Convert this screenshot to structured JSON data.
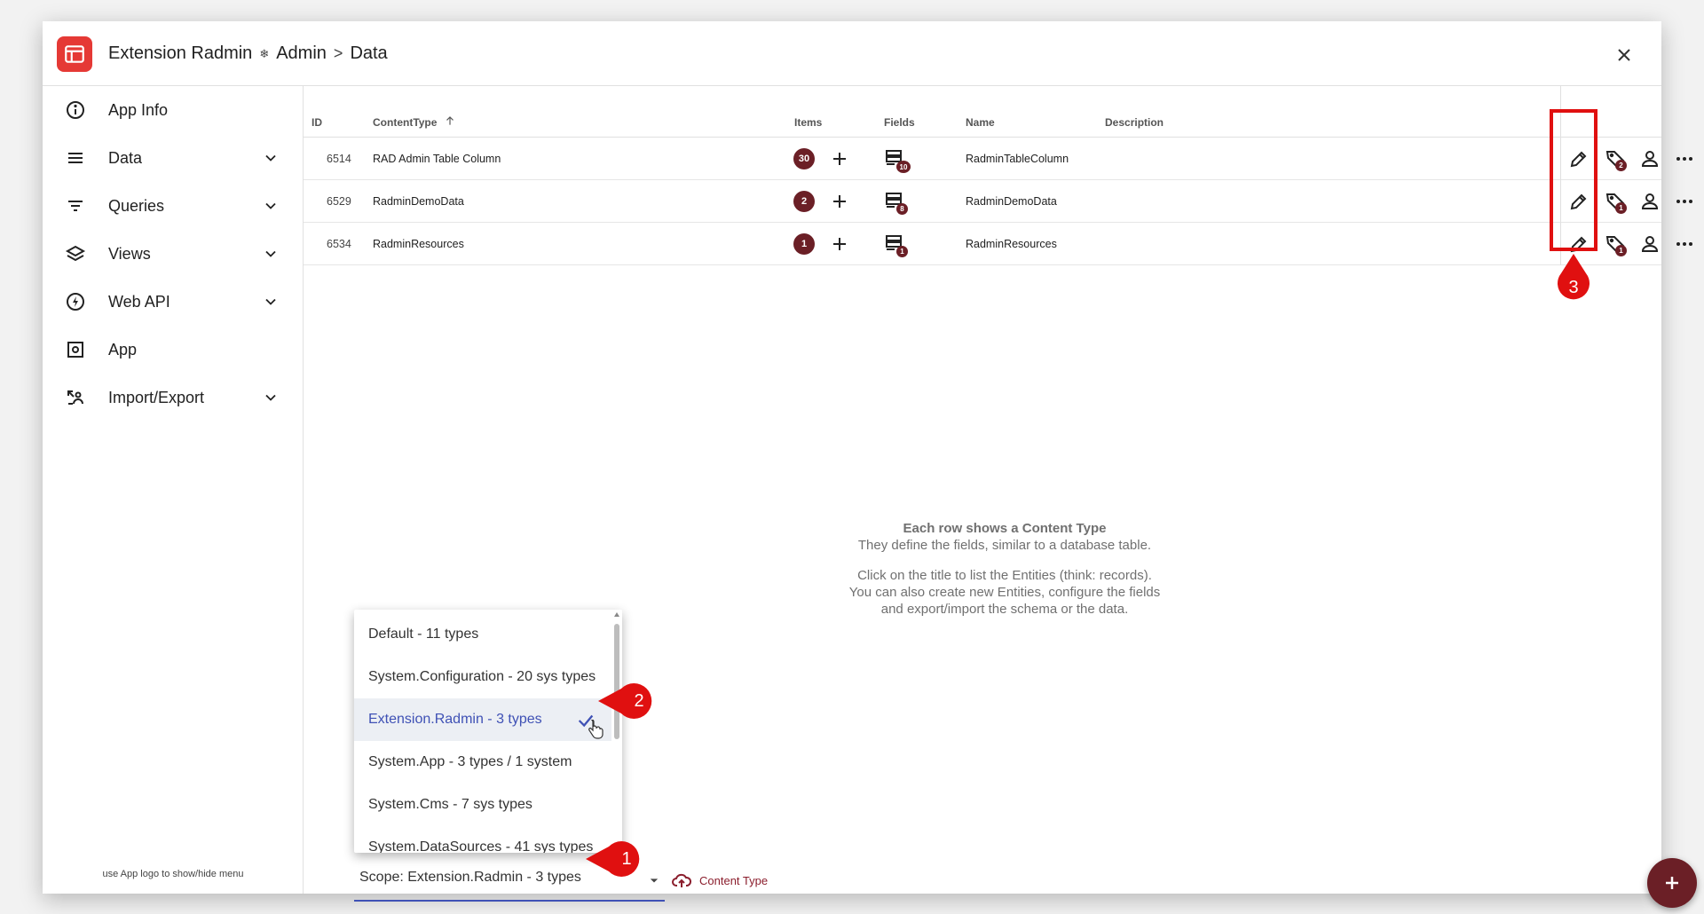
{
  "header": {
    "app_name": "Extension Radmin",
    "section": "Admin",
    "page": "Data",
    "separator_glyph": "❄",
    "arrow_glyph": ">"
  },
  "sidebar": {
    "items": [
      {
        "label": "App Info",
        "icon": "info-icon",
        "has_chevron": false
      },
      {
        "label": "Data",
        "icon": "list-icon",
        "has_chevron": true
      },
      {
        "label": "Queries",
        "icon": "filter-icon",
        "has_chevron": true
      },
      {
        "label": "Views",
        "icon": "layers-icon",
        "has_chevron": true
      },
      {
        "label": "Web API",
        "icon": "bolt-icon",
        "has_chevron": true
      },
      {
        "label": "App",
        "icon": "app-settings-icon",
        "has_chevron": false
      },
      {
        "label": "Import/Export",
        "icon": "import-export-icon",
        "has_chevron": true
      }
    ],
    "hint": "use App logo to show/hide menu"
  },
  "table": {
    "columns": {
      "id": "ID",
      "content_type": "ContentType",
      "items": "Items",
      "fields": "Fields",
      "name": "Name",
      "description": "Description"
    },
    "rows": [
      {
        "id": "6514",
        "content_type": "RAD Admin Table Column",
        "items": "30",
        "fields": "10",
        "name": "RadminTableColumn",
        "metadata": "2",
        "description": ""
      },
      {
        "id": "6529",
        "content_type": "RadminDemoData",
        "items": "2",
        "fields": "8",
        "name": "RadminDemoData",
        "metadata": "1",
        "description": ""
      },
      {
        "id": "6534",
        "content_type": "RadminResources",
        "items": "1",
        "fields": "1",
        "name": "RadminResources",
        "metadata": "1",
        "description": ""
      }
    ]
  },
  "empty_message": {
    "title": "Each row shows a Content Type",
    "line1": "They define the fields, similar to a database table.",
    "line2": "Click on the title to list the Entities (think: records).",
    "line3": "You can also create new Entities, configure the fields",
    "line4": "and export/import the schema or the data."
  },
  "scope_dropdown": {
    "options": [
      {
        "label": "Default - 11 types",
        "selected": false
      },
      {
        "label": "System.Configuration - 20 sys types",
        "selected": false
      },
      {
        "label": "Extension.Radmin - 3 types",
        "selected": true
      },
      {
        "label": "System.App - 3 types / 1 system",
        "selected": false
      },
      {
        "label": "System.Cms - 7 sys types",
        "selected": false
      },
      {
        "label": "System.DataSources - 41 sys types",
        "selected": false
      }
    ]
  },
  "scope_select": {
    "value": "Scope: Extension.Radmin - 3 types"
  },
  "content_type_button": {
    "label": "Content Type"
  },
  "annotations": {
    "c1": "1",
    "c2": "2",
    "c3": "3"
  },
  "colors": {
    "brand": "#e53935",
    "badge": "#6b1f26",
    "accent": "#3f51b5",
    "annotation": "#e01010",
    "link": "#8b1e2d"
  }
}
